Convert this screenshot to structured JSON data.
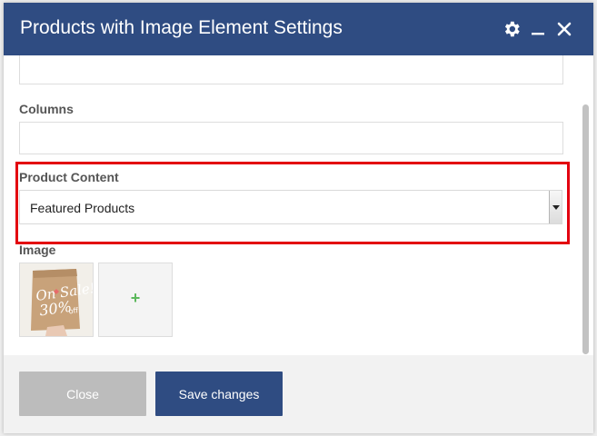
{
  "modal": {
    "title": "Products with Image Element Settings"
  },
  "header_icons": {
    "settings": "gear-icon",
    "minimize": "minimize-icon",
    "close": "close-icon"
  },
  "fields": {
    "top_input_value": "",
    "columns_label": "Columns",
    "columns_value": "",
    "product_content_label": "Product Content",
    "product_content_selected": "Featured Products",
    "image_label": "Image",
    "add_image_symbol": "+"
  },
  "thumbnail": {
    "line1": "On Sale!",
    "line2": "30%",
    "line3": "off"
  },
  "footer": {
    "close_label": "Close",
    "save_label": "Save changes"
  },
  "colors": {
    "header_bg": "#2f4c82",
    "highlight": "#e3000f",
    "save_button": "#2f4c82",
    "close_button": "#bcbcbc",
    "add_plus": "#5cb85c"
  }
}
